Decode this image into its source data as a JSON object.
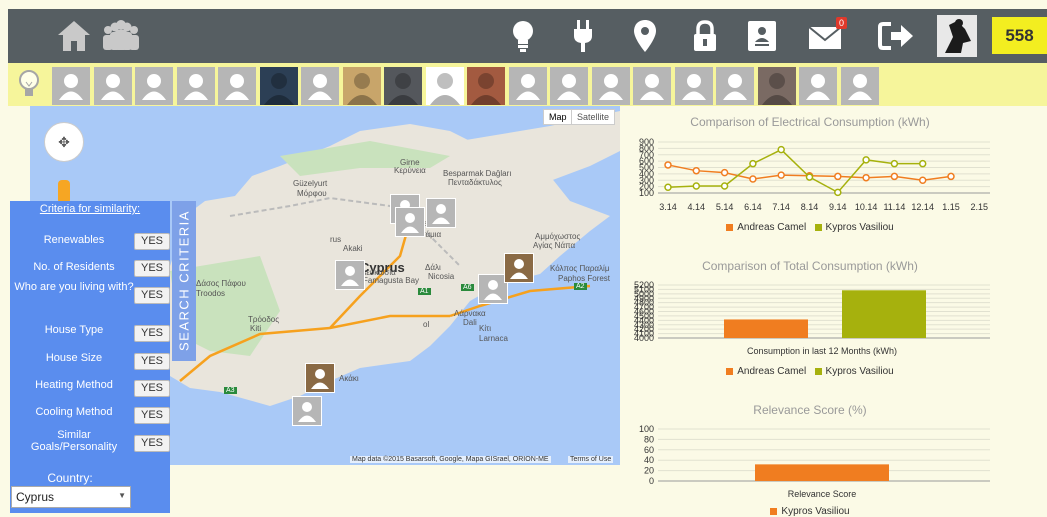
{
  "topbar": {
    "icons": [
      "home-icon",
      "community-icon",
      "lightbulb-icon",
      "plug-icon",
      "location-pin-icon",
      "lock-icon",
      "contact-card-icon",
      "mail-icon",
      "logout-icon"
    ],
    "mail_badge": "0",
    "score": "558",
    "colors": {
      "bar": "#565e62",
      "score_bg": "#f3ee20"
    }
  },
  "map": {
    "type_map": "Map",
    "type_satellite": "Satellite",
    "attribution": "Map data ©2015 Basarsoft, Google, Mapa GISrael, ORION-ME",
    "terms": "Terms of Use",
    "labels": [
      "Girne",
      "Κερύνεια",
      "Besparmak Dağları",
      "Πενταδάκτυλος",
      "Güzelyurt",
      "Μόρφου",
      "Lakatamia",
      "Λακατάμια",
      "Cyprus",
      "Famagusta Bay",
      "Αμμόχωστος",
      "Αγίας Νάπα",
      "Κόλπος Παραλίμ",
      "Paphos Forest",
      "Δάσος Πάφου",
      "Troodos",
      "Τρόοδος",
      "Kiti",
      "Κίτι",
      "Larnaca",
      "Λάρνακα",
      "Dali",
      "Δάλι",
      "Nicosia",
      "Λευκωσία",
      "rus",
      "Akaki",
      "Ακάκι",
      "ol",
      "A1",
      "A2",
      "A3",
      "A5",
      "A6"
    ]
  },
  "criteria": {
    "title": "Criteria for similarity:",
    "tab": "SEARCH CRITERIA",
    "rows": [
      {
        "label": "Renewables",
        "value": "YES"
      },
      {
        "label": "No. of Residents",
        "value": "YES"
      },
      {
        "label": "Who are you living with?",
        "value": "YES"
      },
      {
        "label": "House Type",
        "value": "YES"
      },
      {
        "label": "House Size",
        "value": "YES"
      },
      {
        "label": "Heating Method",
        "value": "YES"
      },
      {
        "label": "Cooling Method",
        "value": "YES"
      },
      {
        "label": "Similar Goals/Personality",
        "value": "YES"
      }
    ],
    "country_label": "Country:",
    "country_value": "Cyprus"
  },
  "legend": {
    "a": "Andreas Camel",
    "b": "Kypros Vasiliou",
    "colors": {
      "a": "#f07d20",
      "b": "#a6b10d"
    }
  },
  "chart_data": [
    {
      "type": "line",
      "title": "Comparison of Electrical Consumption (kWh)",
      "x": [
        "3.14",
        "4.14",
        "5.14",
        "6.14",
        "7.14",
        "8.14",
        "9.14",
        "10.14",
        "11.14",
        "12.14",
        "1.15",
        "2.15"
      ],
      "ylim": [
        100,
        900
      ],
      "yticks": [
        "900",
        "800",
        "700",
        "600",
        "500",
        "400",
        "300",
        "200",
        "100"
      ],
      "series": [
        {
          "name": "Andreas Camel",
          "values": [
            540,
            450,
            420,
            320,
            380,
            370,
            360,
            340,
            360,
            300,
            360,
            null
          ]
        },
        {
          "name": "Kypros Vasiliou",
          "values": [
            190,
            210,
            210,
            560,
            780,
            350,
            110,
            620,
            560,
            560,
            null,
            null
          ]
        }
      ]
    },
    {
      "type": "bar",
      "title": "Comparison of Total Consumption (kWh)",
      "categories": [
        "Consumption in last 12 Months (kWh)"
      ],
      "ylim": [
        4000,
        5200
      ],
      "yticks": [
        "5200",
        "5100",
        "5000",
        "4900",
        "4800",
        "4700",
        "4600",
        "4500",
        "4400",
        "4300",
        "4200",
        "4100",
        "4000"
      ],
      "series": [
        {
          "name": "Andreas Camel",
          "values": [
            4420
          ]
        },
        {
          "name": "Kypros Vasiliou",
          "values": [
            5080
          ]
        }
      ]
    },
    {
      "type": "bar",
      "title": "Relevance Score (%)",
      "categories": [
        "Relevance Score"
      ],
      "ylim": [
        0,
        100
      ],
      "yticks": [
        "100",
        "80",
        "60",
        "40",
        "20",
        "0"
      ],
      "series": [
        {
          "name": "Kypros Vasiliou",
          "values": [
            32
          ]
        }
      ]
    }
  ]
}
